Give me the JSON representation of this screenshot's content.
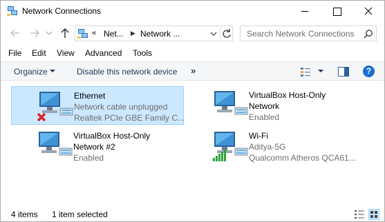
{
  "window": {
    "title": "Network Connections",
    "controls": {
      "minimize": "minimize",
      "maximize": "maximize",
      "close": "close"
    }
  },
  "address_bar": {
    "overflow": "«",
    "segments": [
      "Net...",
      "Network ..."
    ]
  },
  "search": {
    "placeholder": "Search Network Connections"
  },
  "menu": [
    "File",
    "Edit",
    "View",
    "Advanced",
    "Tools"
  ],
  "command_bar": {
    "organize": "Organize",
    "disable": "Disable this network device",
    "more": "»",
    "help": "?"
  },
  "connections": [
    {
      "name": "Ethernet",
      "status": "Network cable unplugged",
      "device": "Realtek PCIe GBE Family C...",
      "selected": true,
      "icon": "ethernet-disconnected-icon"
    },
    {
      "name": "VirtualBox Host-Only",
      "name2": "Network",
      "status": "Enabled",
      "device": "",
      "selected": false,
      "icon": "network-adapter-icon"
    },
    {
      "name": "VirtualBox Host-Only",
      "name2": "Network #2",
      "status": "Enabled",
      "device": "",
      "selected": false,
      "icon": "network-adapter-icon"
    },
    {
      "name": "Wi-Fi",
      "status": "Aditya-5G",
      "device": "Qualcomm Atheros QCA61...",
      "selected": false,
      "icon": "wifi-signal-icon"
    }
  ],
  "status_bar": {
    "count": "4 items",
    "selected": "1 item selected"
  },
  "colors": {
    "selection_bg": "#cce8ff",
    "selection_border": "#99d1ff",
    "command_text": "#1e395b",
    "help_blue": "#1c6dd0",
    "error_red": "#d8262c",
    "signal_green": "#2fa33a"
  }
}
